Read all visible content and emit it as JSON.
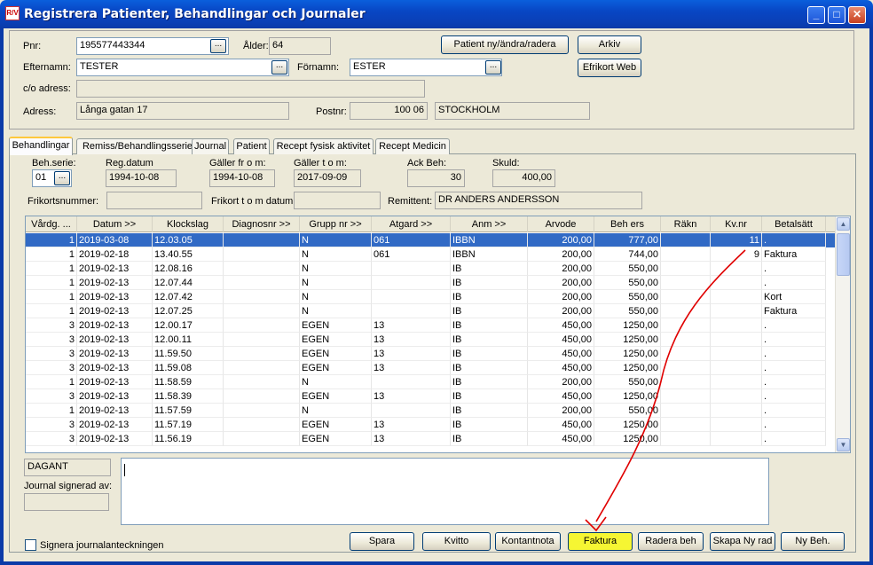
{
  "window": {
    "title": "Registrera Patienter, Behandlingar och Journaler",
    "icon_text": "R/V"
  },
  "patient": {
    "pnr_label": "Pnr:",
    "pnr": "195577443344",
    "alder_label": "Ålder:",
    "alder": "64",
    "efternamn_label": "Efternamn:",
    "efternamn": "TESTER",
    "fornamn_label": "Förnamn:",
    "fornamn": "ESTER",
    "co_label": "c/o adress:",
    "co": "",
    "adress_label": "Adress:",
    "adress": "Långa gatan 17",
    "postnr_label": "Postnr:",
    "postnr": "100 06",
    "ort": "STOCKHOLM",
    "btn_patient": "Patient ny/ändra/radera",
    "btn_arkiv": "Arkiv",
    "btn_efrikort": "Efrikort Web",
    "ellipsis": "..."
  },
  "tabs": [
    "Behandlingar",
    "Remiss/Behandlingsserie",
    "Journal",
    "Patient",
    "Recept fysisk aktivitet",
    "Recept Medicin"
  ],
  "behandling": {
    "behserie_label": "Beh.serie:",
    "behserie": "01",
    "regdatum_label": "Reg.datum",
    "regdatum": "1994-10-08",
    "gallerfrom_label": "Gäller fr o m:",
    "gallerfrom": "1994-10-08",
    "gallertom_label": "Gäller t o m:",
    "gallertom": "2017-09-09",
    "ackbeh_label": "Ack Beh:",
    "ackbeh": "30",
    "skuld_label": "Skuld:",
    "skuld": "400,00",
    "frikortsnummer_label": "Frikortsnummer:",
    "frikortsnummer": "",
    "frikorttom_label": "Frikort t o m datum:",
    "frikorttom": "",
    "remittent_label": "Remittent:",
    "remittent": "DR ANDERS ANDERSSON"
  },
  "grid": {
    "columns": [
      "Vårdg. ...",
      "Datum >>",
      "Klockslag",
      "Diagnosnr >>",
      "Grupp nr >>",
      "Atgard >>",
      "Anm >>",
      "Arvode",
      "Beh ers",
      "Räkn",
      "Kv.nr",
      "Betalsätt"
    ],
    "rows": [
      [
        "1",
        "2019-03-08",
        "12.03.05",
        "",
        "N",
        "061",
        "IBBN",
        "200,00",
        "777,00",
        "",
        "11",
        "."
      ],
      [
        "1",
        "2019-02-18",
        "13.40.55",
        "",
        "N",
        "061",
        "IBBN",
        "200,00",
        "744,00",
        "",
        "9",
        "Faktura"
      ],
      [
        "1",
        "2019-02-13",
        "12.08.16",
        "",
        "N",
        "",
        "IB",
        "200,00",
        "550,00",
        "",
        "",
        "."
      ],
      [
        "1",
        "2019-02-13",
        "12.07.44",
        "",
        "N",
        "",
        "IB",
        "200,00",
        "550,00",
        "",
        "",
        "."
      ],
      [
        "1",
        "2019-02-13",
        "12.07.42",
        "",
        "N",
        "",
        "IB",
        "200,00",
        "550,00",
        "",
        "",
        "Kort"
      ],
      [
        "1",
        "2019-02-13",
        "12.07.25",
        "",
        "N",
        "",
        "IB",
        "200,00",
        "550,00",
        "",
        "",
        "Faktura"
      ],
      [
        "3",
        "2019-02-13",
        "12.00.17",
        "",
        "EGEN",
        "13",
        "IB",
        "450,00",
        "1250,00",
        "",
        "",
        "."
      ],
      [
        "3",
        "2019-02-13",
        "12.00.11",
        "",
        "EGEN",
        "13",
        "IB",
        "450,00",
        "1250,00",
        "",
        "",
        "."
      ],
      [
        "3",
        "2019-02-13",
        "11.59.50",
        "",
        "EGEN",
        "13",
        "IB",
        "450,00",
        "1250,00",
        "",
        "",
        "."
      ],
      [
        "3",
        "2019-02-13",
        "11.59.08",
        "",
        "EGEN",
        "13",
        "IB",
        "450,00",
        "1250,00",
        "",
        "",
        "."
      ],
      [
        "1",
        "2019-02-13",
        "11.58.59",
        "",
        "N",
        "",
        "IB",
        "200,00",
        "550,00",
        "",
        "",
        "."
      ],
      [
        "3",
        "2019-02-13",
        "11.58.39",
        "",
        "EGEN",
        "13",
        "IB",
        "450,00",
        "1250,00",
        "",
        "",
        "."
      ],
      [
        "1",
        "2019-02-13",
        "11.57.59",
        "",
        "N",
        "",
        "IB",
        "200,00",
        "550,00",
        "",
        "",
        "."
      ],
      [
        "3",
        "2019-02-13",
        "11.57.19",
        "",
        "EGEN",
        "13",
        "IB",
        "450,00",
        "1250,00",
        "",
        "",
        "."
      ],
      [
        "3",
        "2019-02-13",
        "11.56.19",
        "",
        "EGEN",
        "13",
        "IB",
        "450,00",
        "1250,00",
        "",
        "",
        "."
      ]
    ],
    "selected_row": 0
  },
  "journal": {
    "signerare": "DAGANT",
    "signerad_label": "Journal signerad av:",
    "signerad": "",
    "text": "",
    "signera_label": "Signera journalanteckningen"
  },
  "buttons": {
    "spara": "Spara",
    "kvitto": "Kvitto",
    "kontantnota": "Kontantnota",
    "faktura": "Faktura",
    "radera": "Radera beh",
    "skapa": "Skapa Ny rad",
    "ny": "Ny Beh."
  },
  "colors": {
    "title_bar": "#0a3fb5",
    "selection": "#316ac5",
    "highlight": "#f6f633",
    "annotation": "#e00000"
  }
}
